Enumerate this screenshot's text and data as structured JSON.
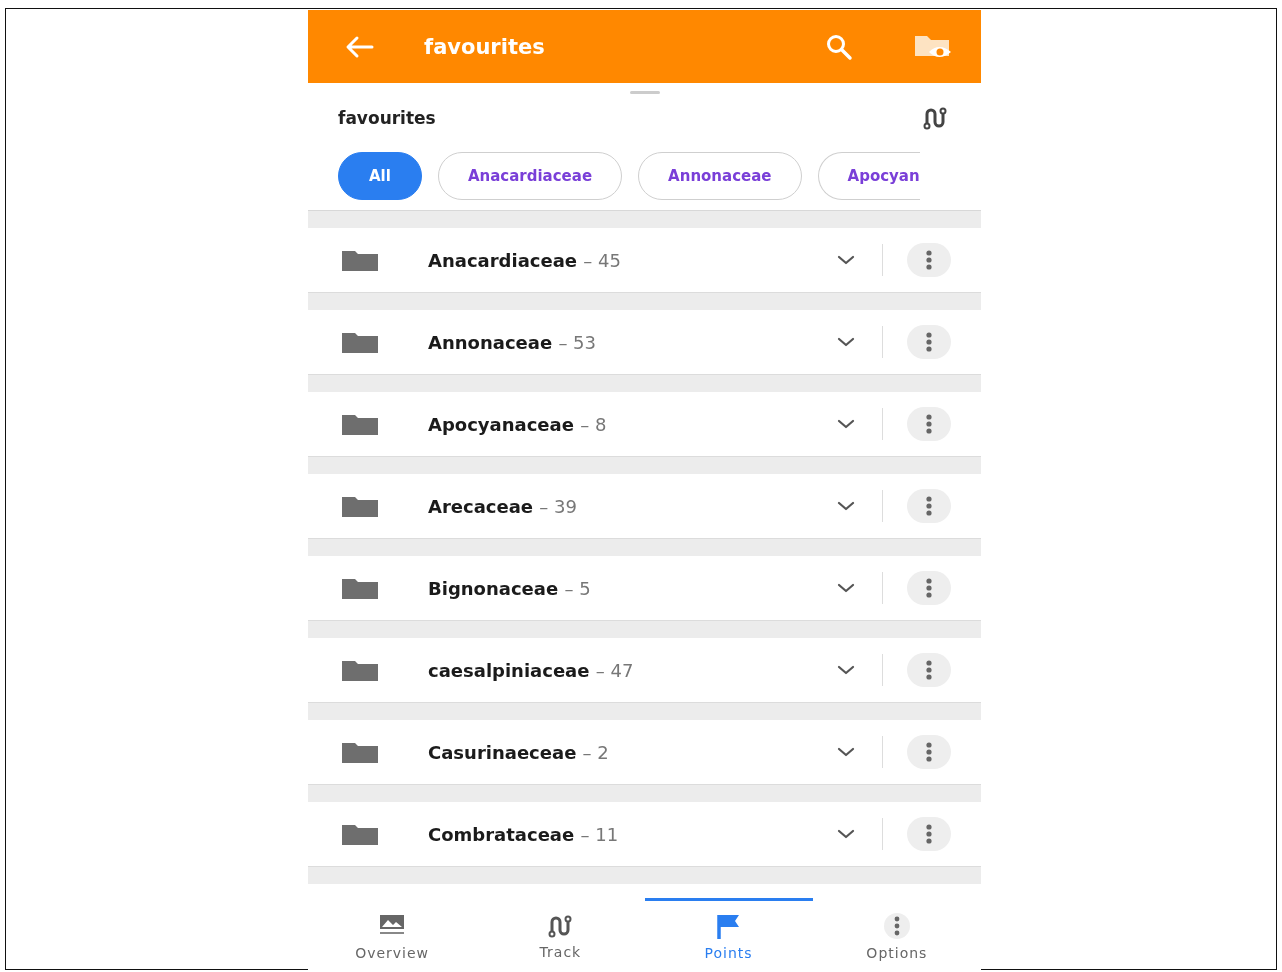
{
  "app_bar": {
    "title": "favourites"
  },
  "sheet": {
    "title": "favourites"
  },
  "chips": [
    {
      "label": "All",
      "selected": true
    },
    {
      "label": "Anacardiaceae",
      "selected": false
    },
    {
      "label": "Annonaceae",
      "selected": false
    },
    {
      "label": "Apocyan",
      "selected": false
    }
  ],
  "groups": [
    {
      "name": "Anacardiaceae",
      "count": "– 45"
    },
    {
      "name": "Annonaceae",
      "count": "– 53"
    },
    {
      "name": "Apocyanaceae",
      "count": "– 8"
    },
    {
      "name": "Arecaceae",
      "count": "– 39"
    },
    {
      "name": "Bignonaceae",
      "count": "– 5"
    },
    {
      "name": "caesalpiniaceae",
      "count": "– 47"
    },
    {
      "name": "Casurinaeceae",
      "count": "– 2"
    },
    {
      "name": "Combrataceae",
      "count": "– 11"
    }
  ],
  "nav": [
    {
      "label": "Overview",
      "selected": false
    },
    {
      "label": "Track",
      "selected": false
    },
    {
      "label": "Points",
      "selected": true
    },
    {
      "label": "Options",
      "selected": false
    }
  ]
}
